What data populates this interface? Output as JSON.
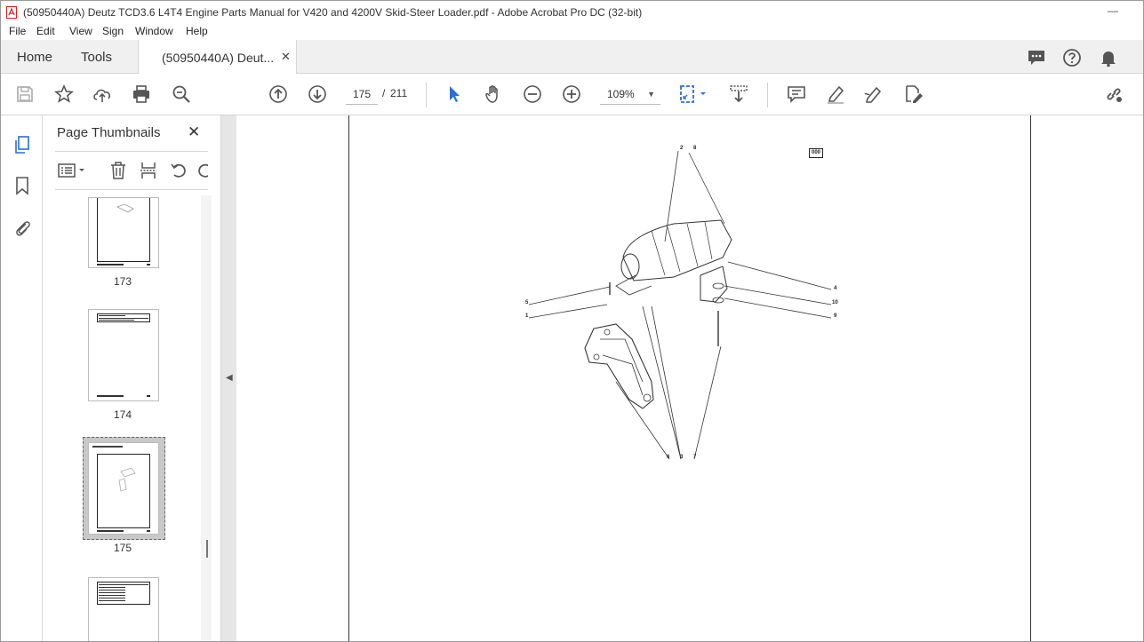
{
  "window": {
    "title": "(50950440A) Deutz TCD3.6 L4T4 Engine Parts Manual for V420 and 4200V Skid-Steer Loader.pdf - Adobe Acrobat Pro DC (32-bit)",
    "minimize_glyph": "—"
  },
  "menu": {
    "file": "File",
    "edit": "Edit",
    "view": "View",
    "sign": "Sign",
    "window": "Window",
    "help": "Help"
  },
  "tabs": {
    "home": "Home",
    "tools": "Tools",
    "document": "(50950440A) Deut...",
    "close_glyph": "✕"
  },
  "toolbar": {
    "current_page": "175",
    "page_separator": "/",
    "total_pages": "211",
    "zoom": "109%",
    "icons": [
      "save-icon",
      "bookmark-star-icon",
      "upload-icon",
      "print-icon",
      "search-zoom-icon",
      "prev-page-icon",
      "next-page-icon",
      "select-pointer-icon",
      "hand-icon",
      "zoom-out-icon",
      "zoom-in-icon",
      "page-fit-icon",
      "scroll-mode-icon",
      "comment-icon",
      "highlight-icon",
      "sign-icon",
      "edit-pdf-icon",
      "share-link-icon"
    ]
  },
  "thumbnails_panel": {
    "title": "Page Thumbnails",
    "close_glyph": "✕",
    "pages": [
      {
        "number": "173",
        "selected": false
      },
      {
        "number": "174",
        "selected": false
      },
      {
        "number": "175",
        "selected": true
      },
      {
        "number": "",
        "selected": false
      }
    ]
  },
  "document": {
    "page_code": "000",
    "callouts": [
      "2",
      "8",
      "5",
      "1",
      "4",
      "10",
      "9",
      "6",
      "3",
      "7"
    ]
  },
  "colors": {
    "accent_blue": "#2b6fd1",
    "acrobat_red": "#d1261f",
    "panel_border": "#d6d6d6"
  }
}
